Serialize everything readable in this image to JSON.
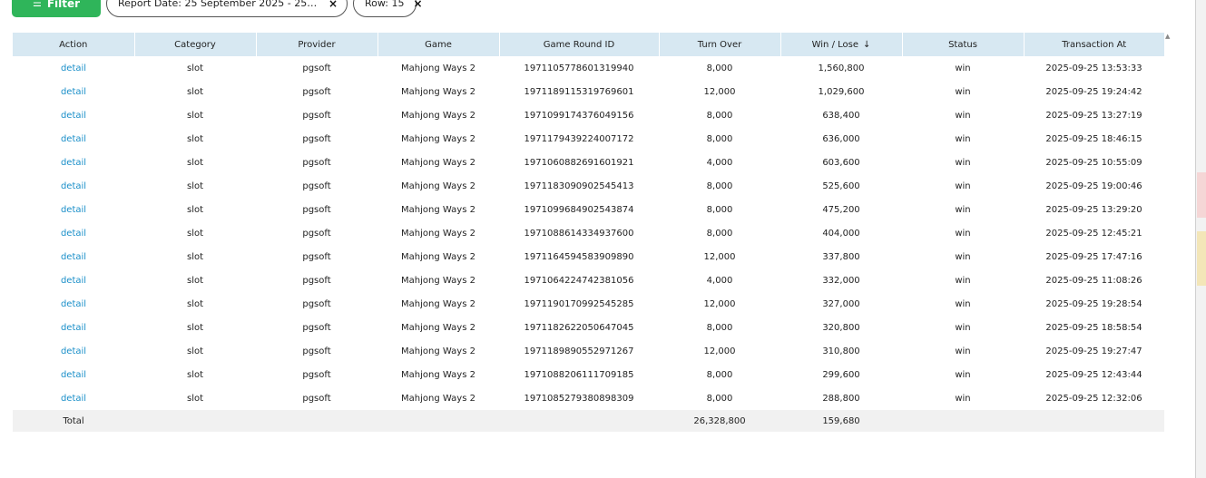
{
  "toolbar": {
    "filter_label": "Filter",
    "filter_icon": "filter-icon",
    "chips": [
      {
        "label": "Report Date: 25 September 2025 - 25 Septe...",
        "close": "×"
      },
      {
        "label": "Row: 15",
        "close": "×"
      }
    ]
  },
  "table": {
    "columns": [
      "Action",
      "Category",
      "Provider",
      "Game",
      "Game Round ID",
      "Turn Over",
      "Win / Lose",
      "Status",
      "Transaction At"
    ],
    "sort_indicator": "↓",
    "scroll_indicator": "▲",
    "rows": [
      {
        "action": "detail",
        "category": "slot",
        "provider": "pgsoft",
        "game": "Mahjong Ways 2",
        "round_id": "1971105778601319940",
        "turnover": "8,000",
        "winlose": "1,560,800",
        "status": "win",
        "time": "2025-09-25 13:53:33"
      },
      {
        "action": "detail",
        "category": "slot",
        "provider": "pgsoft",
        "game": "Mahjong Ways 2",
        "round_id": "1971189115319769601",
        "turnover": "12,000",
        "winlose": "1,029,600",
        "status": "win",
        "time": "2025-09-25 19:24:42"
      },
      {
        "action": "detail",
        "category": "slot",
        "provider": "pgsoft",
        "game": "Mahjong Ways 2",
        "round_id": "1971099174376049156",
        "turnover": "8,000",
        "winlose": "638,400",
        "status": "win",
        "time": "2025-09-25 13:27:19"
      },
      {
        "action": "detail",
        "category": "slot",
        "provider": "pgsoft",
        "game": "Mahjong Ways 2",
        "round_id": "1971179439224007172",
        "turnover": "8,000",
        "winlose": "636,000",
        "status": "win",
        "time": "2025-09-25 18:46:15"
      },
      {
        "action": "detail",
        "category": "slot",
        "provider": "pgsoft",
        "game": "Mahjong Ways 2",
        "round_id": "1971060882691601921",
        "turnover": "4,000",
        "winlose": "603,600",
        "status": "win",
        "time": "2025-09-25 10:55:09"
      },
      {
        "action": "detail",
        "category": "slot",
        "provider": "pgsoft",
        "game": "Mahjong Ways 2",
        "round_id": "1971183090902545413",
        "turnover": "8,000",
        "winlose": "525,600",
        "status": "win",
        "time": "2025-09-25 19:00:46"
      },
      {
        "action": "detail",
        "category": "slot",
        "provider": "pgsoft",
        "game": "Mahjong Ways 2",
        "round_id": "1971099684902543874",
        "turnover": "8,000",
        "winlose": "475,200",
        "status": "win",
        "time": "2025-09-25 13:29:20"
      },
      {
        "action": "detail",
        "category": "slot",
        "provider": "pgsoft",
        "game": "Mahjong Ways 2",
        "round_id": "1971088614334937600",
        "turnover": "8,000",
        "winlose": "404,000",
        "status": "win",
        "time": "2025-09-25 12:45:21"
      },
      {
        "action": "detail",
        "category": "slot",
        "provider": "pgsoft",
        "game": "Mahjong Ways 2",
        "round_id": "1971164594583909890",
        "turnover": "12,000",
        "winlose": "337,800",
        "status": "win",
        "time": "2025-09-25 17:47:16"
      },
      {
        "action": "detail",
        "category": "slot",
        "provider": "pgsoft",
        "game": "Mahjong Ways 2",
        "round_id": "1971064224742381056",
        "turnover": "4,000",
        "winlose": "332,000",
        "status": "win",
        "time": "2025-09-25 11:08:26"
      },
      {
        "action": "detail",
        "category": "slot",
        "provider": "pgsoft",
        "game": "Mahjong Ways 2",
        "round_id": "1971190170992545285",
        "turnover": "12,000",
        "winlose": "327,000",
        "status": "win",
        "time": "2025-09-25 19:28:54"
      },
      {
        "action": "detail",
        "category": "slot",
        "provider": "pgsoft",
        "game": "Mahjong Ways 2",
        "round_id": "1971182622050647045",
        "turnover": "8,000",
        "winlose": "320,800",
        "status": "win",
        "time": "2025-09-25 18:58:54"
      },
      {
        "action": "detail",
        "category": "slot",
        "provider": "pgsoft",
        "game": "Mahjong Ways 2",
        "round_id": "1971189890552971267",
        "turnover": "12,000",
        "winlose": "310,800",
        "status": "win",
        "time": "2025-09-25 19:27:47"
      },
      {
        "action": "detail",
        "category": "slot",
        "provider": "pgsoft",
        "game": "Mahjong Ways 2",
        "round_id": "1971088206111709185",
        "turnover": "8,000",
        "winlose": "299,600",
        "status": "win",
        "time": "2025-09-25 12:43:44"
      },
      {
        "action": "detail",
        "category": "slot",
        "provider": "pgsoft",
        "game": "Mahjong Ways 2",
        "round_id": "1971085279380898309",
        "turnover": "8,000",
        "winlose": "288,800",
        "status": "win",
        "time": "2025-09-25 12:32:06"
      }
    ],
    "total": {
      "label": "Total",
      "turnover": "26,328,800",
      "winlose": "159,680"
    }
  }
}
